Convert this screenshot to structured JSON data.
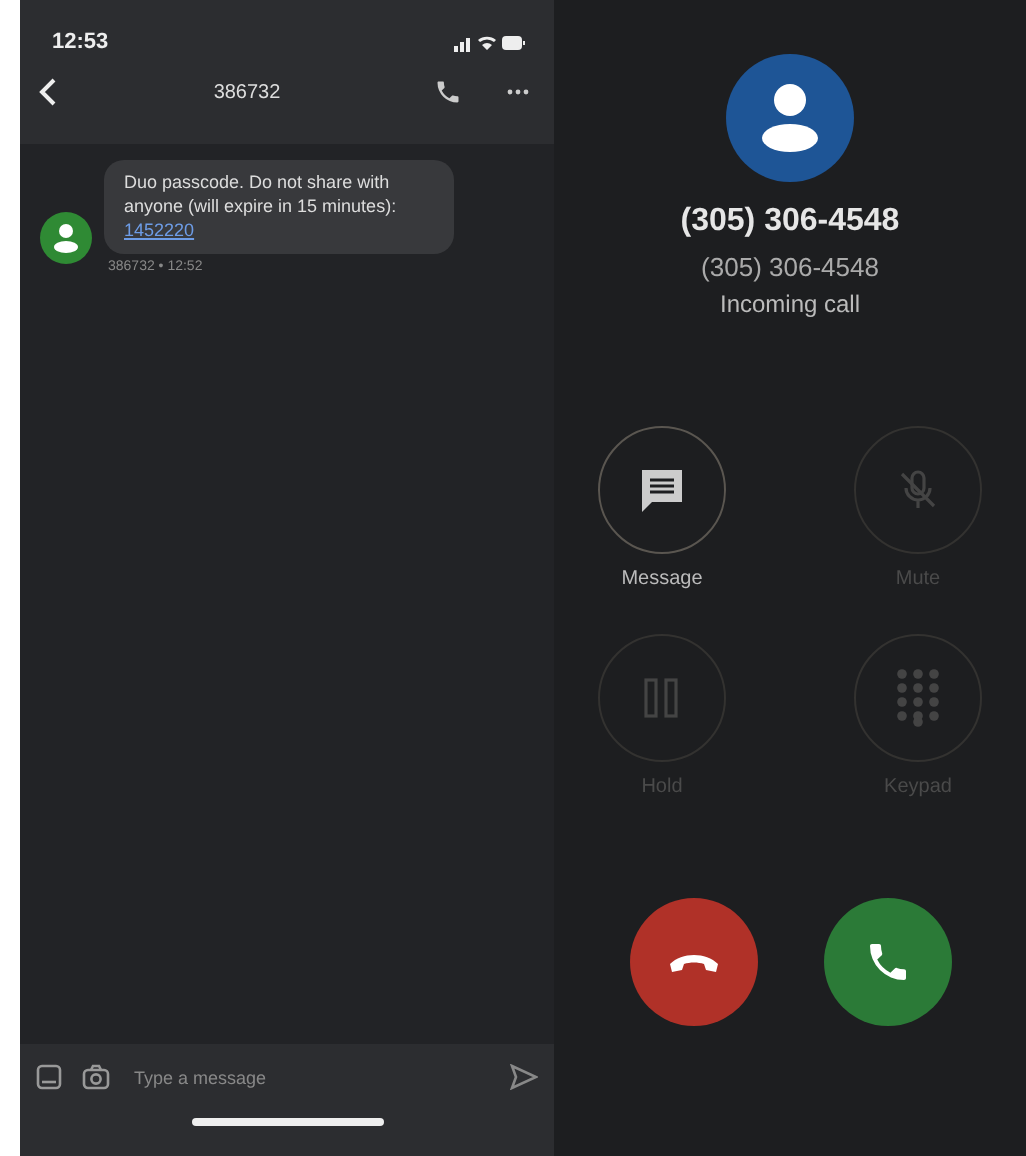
{
  "status_bar": {
    "time": "12:53"
  },
  "conversation": {
    "title": "386732",
    "message": {
      "text": "Duo passcode. Do not share with anyone (will expire in 15 minutes):",
      "code": "1452220",
      "meta": "386732 • 12:52"
    },
    "input": {
      "placeholder": "Type a message"
    }
  },
  "call": {
    "caller": "(305) 306-4548",
    "number": "(305) 306-4548",
    "status": "Incoming call",
    "actions": [
      {
        "kind": "message",
        "label": "Message",
        "disabled": false
      },
      {
        "kind": "mute",
        "label": "Mute",
        "disabled": true
      },
      {
        "kind": "hold",
        "label": "Hold",
        "disabled": true
      },
      {
        "kind": "keypad",
        "label": "Keypad",
        "disabled": true
      }
    ]
  }
}
